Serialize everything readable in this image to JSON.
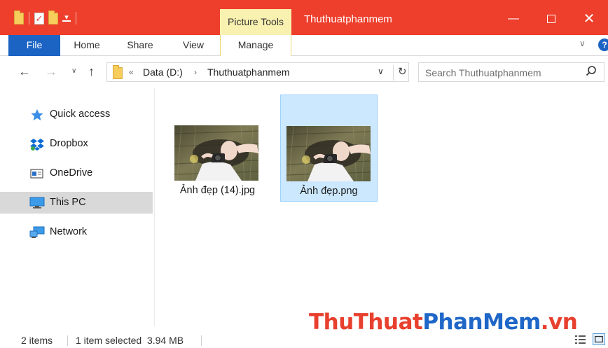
{
  "window": {
    "title": "Thuthuatphanmem",
    "context_group": "Picture Tools",
    "minimize": "—",
    "close": "✕"
  },
  "ribbon": {
    "tabs": [
      "File",
      "Home",
      "Share",
      "View",
      "Manage"
    ],
    "collapse_glyph": "∨",
    "help_glyph": "?"
  },
  "navigation": {
    "back": "←",
    "forward": "→",
    "recent": "∨",
    "up": "↑"
  },
  "address": {
    "overflow": "«",
    "separator": "›",
    "crumbs": [
      "Data (D:)",
      "Thuthuatphanmem"
    ],
    "dropdown": "∨",
    "refresh": "↻"
  },
  "search": {
    "placeholder": "Search Thuthuatphanmem"
  },
  "sidebar": {
    "items": [
      {
        "label": "Quick access",
        "icon": "star-icon"
      },
      {
        "label": "Dropbox",
        "icon": "dropbox-icon"
      },
      {
        "label": "OneDrive",
        "icon": "onedrive-icon"
      },
      {
        "label": "This PC",
        "icon": "computer-icon",
        "selected": true
      },
      {
        "label": "Network",
        "icon": "network-icon"
      }
    ]
  },
  "files": [
    {
      "name": "Ảnh đẹp (14).jpg",
      "selected": false
    },
    {
      "name": "Ảnh đẹp.png",
      "selected": true
    }
  ],
  "status": {
    "count": "2 items",
    "selection": "1 item selected  3.94 MB"
  },
  "watermark": {
    "part1": "ThuThuat",
    "part2": "PhanMem",
    "part3": ".vn"
  },
  "colors": {
    "titlebar": "#ed3f2c",
    "file_tab": "#1b64c4",
    "context_tab": "#f9f1b0",
    "selection": "#cce8ff",
    "nav_selected": "#d9d9d9",
    "watermark_red": "#e8402e",
    "watermark_blue": "#1e66c7"
  }
}
